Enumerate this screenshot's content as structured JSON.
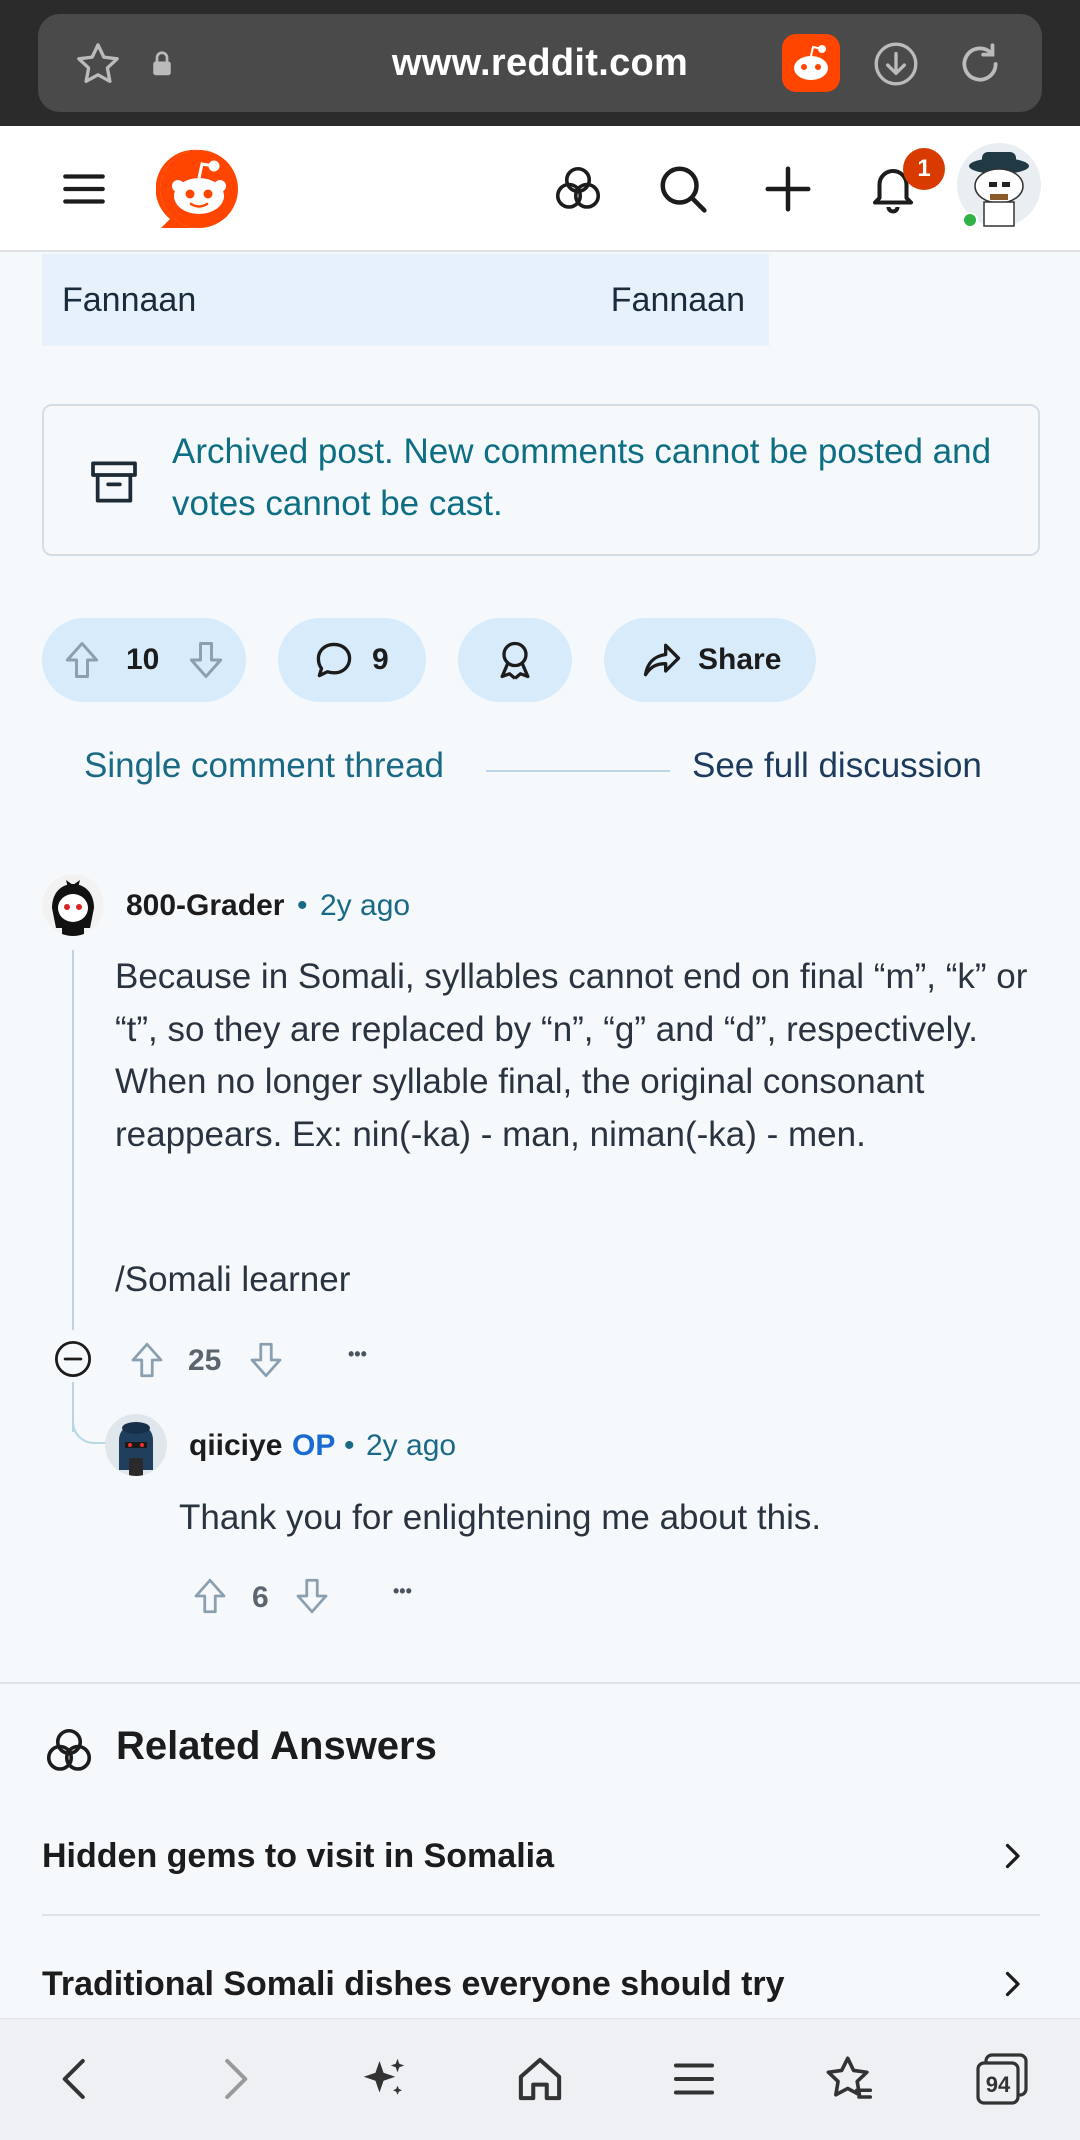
{
  "browser": {
    "url": "www.reddit.com",
    "tab_count": "94"
  },
  "header": {
    "notification_count": "1"
  },
  "translation": {
    "left": "Fannaan",
    "right": "Fannaan"
  },
  "archived_notice": "Archived post. New comments cannot be posted and votes cannot be cast.",
  "post_actions": {
    "votes": "10",
    "comments": "9",
    "share_label": "Share"
  },
  "thread_nav": {
    "single": "Single comment thread",
    "full": "See full discussion"
  },
  "comments": [
    {
      "username": "800-Grader",
      "separator": "•",
      "time": "2y ago",
      "paragraphs": [
        "Because in Somali, syllables cannot end on final “m”, “k” or “t”, so they are replaced by “n”, “g” and “d”, respectively. When no longer syllable final, the original consonant reappears. Ex: nin(-ka) - man, niman(-ka) - men.",
        "/Somali learner"
      ],
      "votes": "25",
      "more": "•••"
    },
    {
      "username": "qiiciye",
      "op_label": "OP",
      "separator": "•",
      "time": "2y ago",
      "paragraphs": [
        "Thank you for enlightening me about this."
      ],
      "votes": "6",
      "more": "•••"
    }
  ],
  "related": {
    "title": "Related Answers",
    "items": [
      "Hidden gems to visit in Somalia",
      "Traditional Somali dishes everyone should try"
    ]
  },
  "colors": {
    "accent": "#1a6a86",
    "reddit_orange": "#ff4500",
    "pill_bg": "#d7ebfa",
    "op_blue": "#1a6bd1"
  }
}
